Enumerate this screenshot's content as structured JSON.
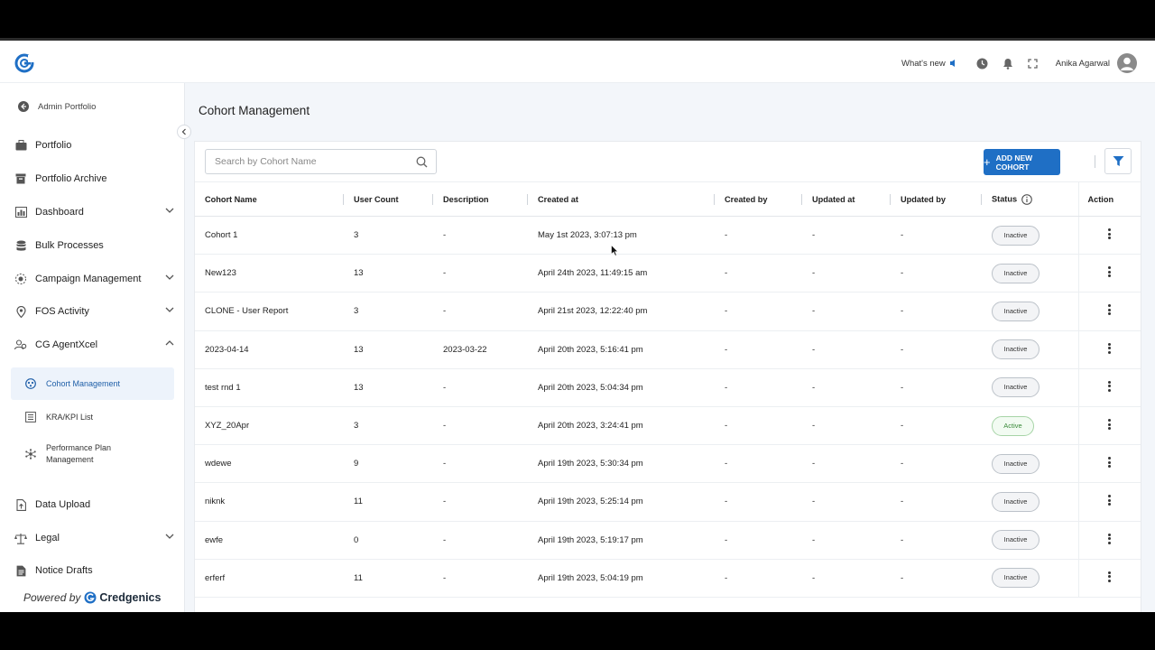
{
  "header": {
    "whats_new": "What's new",
    "user_name": "Anika Agarwal",
    "icons": [
      "megaphone-icon",
      "clock-icon",
      "bell-icon",
      "fullscreen-icon",
      "user-avatar-icon"
    ]
  },
  "sidebar": {
    "back_label": "Admin Portfolio",
    "items": [
      {
        "label": "Portfolio",
        "icon": "briefcase-icon",
        "expandable": false
      },
      {
        "label": "Portfolio Archive",
        "icon": "archive-icon",
        "expandable": false
      },
      {
        "label": "Dashboard",
        "icon": "dashboard-icon",
        "expandable": true
      },
      {
        "label": "Bulk Processes",
        "icon": "database-icon",
        "expandable": false
      },
      {
        "label": "Campaign Management",
        "icon": "campaign-icon",
        "expandable": true
      },
      {
        "label": "FOS Activity",
        "icon": "location-pin-icon",
        "expandable": true
      },
      {
        "label": "CG AgentXcel",
        "icon": "agents-icon",
        "expandable": true,
        "expanded": true
      }
    ],
    "sub_items": [
      {
        "label": "Cohort Management",
        "icon": "cohort-icon",
        "active": true
      },
      {
        "label": "KRA/KPI List",
        "icon": "list-icon",
        "active": false
      },
      {
        "label": "Performance Plan Management",
        "icon": "network-icon",
        "active": false
      }
    ],
    "bottom_items": [
      {
        "label": "Data Upload",
        "icon": "upload-icon",
        "expandable": false
      },
      {
        "label": "Legal",
        "icon": "scales-icon",
        "expandable": true
      },
      {
        "label": "Notice Drafts",
        "icon": "document-icon",
        "expandable": false
      }
    ],
    "powered_by": "Powered by",
    "brand": "Credgenics"
  },
  "main": {
    "title": "Cohort Management",
    "search_placeholder": "Search by Cohort Name",
    "add_button": "ADD NEW COHORT",
    "columns": [
      "Cohort Name",
      "User Count",
      "Description",
      "Created at",
      "Created by",
      "Updated at",
      "Updated by",
      "Status",
      "Action"
    ],
    "rows": [
      {
        "name": "Cohort 1",
        "count": "3",
        "desc": "-",
        "created_at": "May 1st 2023, 3:07:13 pm",
        "created_by": "-",
        "updated_at": "-",
        "updated_by": "-",
        "status": "Inactive"
      },
      {
        "name": "New123",
        "count": "13",
        "desc": "-",
        "created_at": "April 24th 2023, 11:49:15 am",
        "created_by": "-",
        "updated_at": "-",
        "updated_by": "-",
        "status": "Inactive"
      },
      {
        "name": "CLONE - User Report",
        "count": "3",
        "desc": "-",
        "created_at": "April 21st 2023, 12:22:40 pm",
        "created_by": "-",
        "updated_at": "-",
        "updated_by": "-",
        "status": "Inactive"
      },
      {
        "name": "2023-04-14",
        "count": "13",
        "desc": "2023-03-22",
        "created_at": "April 20th 2023, 5:16:41 pm",
        "created_by": "-",
        "updated_at": "-",
        "updated_by": "-",
        "status": "Inactive"
      },
      {
        "name": "test rnd 1",
        "count": "13",
        "desc": "-",
        "created_at": "April 20th 2023, 5:04:34 pm",
        "created_by": "-",
        "updated_at": "-",
        "updated_by": "-",
        "status": "Inactive"
      },
      {
        "name": "XYZ_20Apr",
        "count": "3",
        "desc": "-",
        "created_at": "April 20th 2023, 3:24:41 pm",
        "created_by": "-",
        "updated_at": "-",
        "updated_by": "-",
        "status": "Active"
      },
      {
        "name": "wdewe",
        "count": "9",
        "desc": "-",
        "created_at": "April 19th 2023, 5:30:34 pm",
        "created_by": "-",
        "updated_at": "-",
        "updated_by": "-",
        "status": "Inactive"
      },
      {
        "name": "niknk",
        "count": "11",
        "desc": "-",
        "created_at": "April 19th 2023, 5:25:14 pm",
        "created_by": "-",
        "updated_at": "-",
        "updated_by": "-",
        "status": "Inactive"
      },
      {
        "name": "ewfe",
        "count": "0",
        "desc": "-",
        "created_at": "April 19th 2023, 5:19:17 pm",
        "created_by": "-",
        "updated_at": "-",
        "updated_by": "-",
        "status": "Inactive"
      },
      {
        "name": "erferf",
        "count": "11",
        "desc": "-",
        "created_at": "April 19th 2023, 5:04:19 pm",
        "created_by": "-",
        "updated_at": "-",
        "updated_by": "-",
        "status": "Inactive"
      }
    ]
  },
  "colors": {
    "accent": "#1f6fc5",
    "active_status": "#3a8a3a",
    "sidebar_active_bg": "#edf3fb"
  }
}
